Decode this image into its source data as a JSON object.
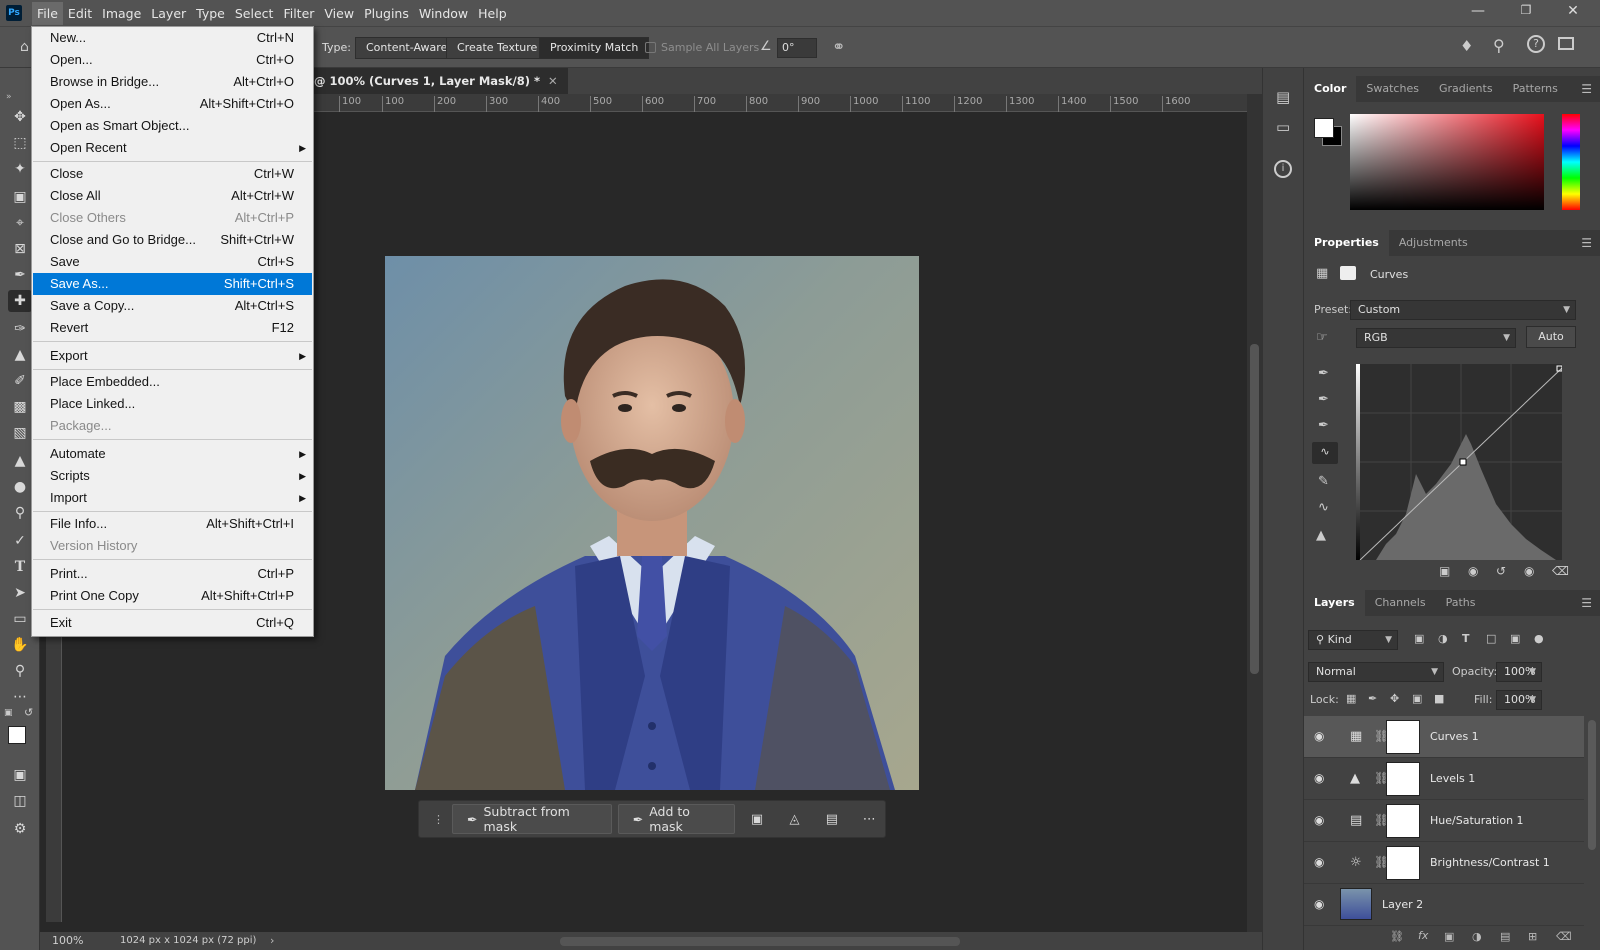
{
  "menubar": {
    "items": [
      "File",
      "Edit",
      "Image",
      "Layer",
      "Type",
      "Select",
      "Filter",
      "View",
      "Plugins",
      "Window",
      "Help"
    ],
    "active": "File"
  },
  "options": {
    "type_label": "Type:",
    "type_buttons": [
      "Content-Aware",
      "Create Texture",
      "Proximity Match"
    ],
    "selected_type": "Proximity Match",
    "sample_all_layers": "Sample All Layers",
    "angle_value": "0°"
  },
  "document": {
    "tab_title": "@ 100% (Curves 1, Layer Mask/8) *",
    "zoom": "100%",
    "doc_info": "1024 px x 1024 px (72 ppi)",
    "ruler_ticks": [
      "100",
      "100",
      "200",
      "300",
      "400",
      "500",
      "600",
      "700",
      "800",
      "900",
      "1000",
      "1100",
      "1200",
      "1300",
      "1400",
      "1500",
      "1600"
    ]
  },
  "contextual_taskbar": {
    "subtract": "Subtract from mask",
    "add": "Add to mask"
  },
  "file_menu": {
    "items": [
      {
        "label": "New...",
        "shortcut": "Ctrl+N"
      },
      {
        "label": "Open...",
        "shortcut": "Ctrl+O"
      },
      {
        "label": "Browse in Bridge...",
        "shortcut": "Alt+Ctrl+O"
      },
      {
        "label": "Open As...",
        "shortcut": "Alt+Shift+Ctrl+O"
      },
      {
        "label": "Open as Smart Object...",
        "shortcut": ""
      },
      {
        "label": "Open Recent",
        "shortcut": "",
        "submenu": true
      },
      {
        "label": "Close",
        "shortcut": "Ctrl+W"
      },
      {
        "label": "Close All",
        "shortcut": "Alt+Ctrl+W"
      },
      {
        "label": "Close Others",
        "shortcut": "Alt+Ctrl+P",
        "disabled": true
      },
      {
        "label": "Close and Go to Bridge...",
        "shortcut": "Shift+Ctrl+W"
      },
      {
        "label": "Save",
        "shortcut": "Ctrl+S"
      },
      {
        "label": "Save As...",
        "shortcut": "Shift+Ctrl+S",
        "highlighted": true
      },
      {
        "label": "Save a Copy...",
        "shortcut": "Alt+Ctrl+S"
      },
      {
        "label": "Revert",
        "shortcut": "F12"
      },
      {
        "label": "Export",
        "shortcut": "",
        "submenu": true
      },
      {
        "label": "Place Embedded...",
        "shortcut": ""
      },
      {
        "label": "Place Linked...",
        "shortcut": ""
      },
      {
        "label": "Package...",
        "shortcut": "",
        "disabled": true
      },
      {
        "label": "Automate",
        "shortcut": "",
        "submenu": true
      },
      {
        "label": "Scripts",
        "shortcut": "",
        "submenu": true
      },
      {
        "label": "Import",
        "shortcut": "",
        "submenu": true
      },
      {
        "label": "File Info...",
        "shortcut": "Alt+Shift+Ctrl+I"
      },
      {
        "label": "Version History",
        "shortcut": "",
        "disabled": true
      },
      {
        "label": "Print...",
        "shortcut": "Ctrl+P"
      },
      {
        "label": "Print One Copy",
        "shortcut": "Alt+Shift+Ctrl+P"
      },
      {
        "label": "Exit",
        "shortcut": "Ctrl+Q"
      }
    ]
  },
  "color_panel": {
    "tabs": [
      "Color",
      "Swatches",
      "Gradients",
      "Patterns"
    ],
    "active_tab": "Color",
    "hue_color": "#e8101c"
  },
  "properties_panel": {
    "tabs": [
      "Properties",
      "Adjustments"
    ],
    "active_tab": "Properties",
    "type": "Curves",
    "preset_label": "Preset:",
    "preset_value": "Custom",
    "channel_value": "RGB",
    "auto_label": "Auto"
  },
  "layers_panel": {
    "tabs": [
      "Layers",
      "Channels",
      "Paths"
    ],
    "active_tab": "Layers",
    "kind_label": "Kind",
    "blend_mode": "Normal",
    "opacity_label": "Opacity:",
    "opacity_value": "100%",
    "lock_label": "Lock:",
    "fill_label": "Fill:",
    "fill_value": "100%",
    "layers": [
      {
        "name": "Curves 1",
        "icon": "curves-icon",
        "selected": true
      },
      {
        "name": "Levels 1",
        "icon": "levels-icon"
      },
      {
        "name": "Hue/Saturation 1",
        "icon": "hue-saturation-icon"
      },
      {
        "name": "Brightness/Contrast 1",
        "icon": "brightness-icon"
      },
      {
        "name": "Layer 2",
        "icon": "photo-thumbnail"
      }
    ]
  }
}
